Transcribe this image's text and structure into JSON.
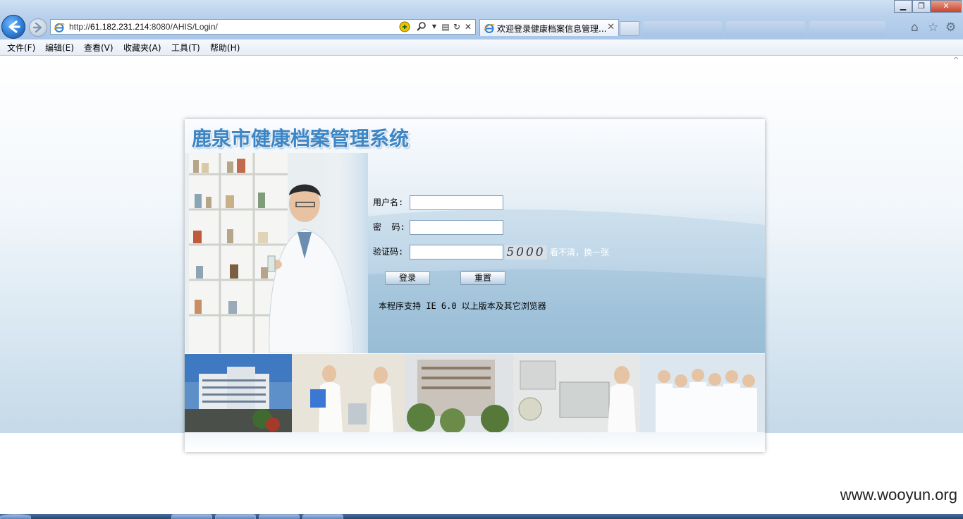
{
  "browser": {
    "address": {
      "prefix": "http://",
      "host": "61.182.231.214",
      "rest": ":8080/AHIS/Login/"
    },
    "tab_title": "欢迎登录健康档案信息管理...",
    "menu": [
      "文件(F)",
      "编辑(E)",
      "查看(V)",
      "收藏夹(A)",
      "工具(T)",
      "帮助(H)"
    ],
    "icons": [
      "back-arrow-icon",
      "forward-arrow-icon",
      "ie-logo-icon",
      "search-icon",
      "refresh-icon",
      "close-icon",
      "home-icon",
      "favorites-star-icon",
      "settings-gear-icon"
    ]
  },
  "login": {
    "system_title": "鹿泉市健康档案管理系统",
    "username_label": "用户名:",
    "password_label": "密  码:",
    "captcha_label": "验证码:",
    "captcha_code": "5000",
    "refresh_link": "看不清，换一张",
    "login_button": "登录",
    "reset_button": "重置",
    "support_note": "本程序支持 IE 6.0 以上版本及其它浏览器"
  },
  "watermark": "www.wooyun.org"
}
